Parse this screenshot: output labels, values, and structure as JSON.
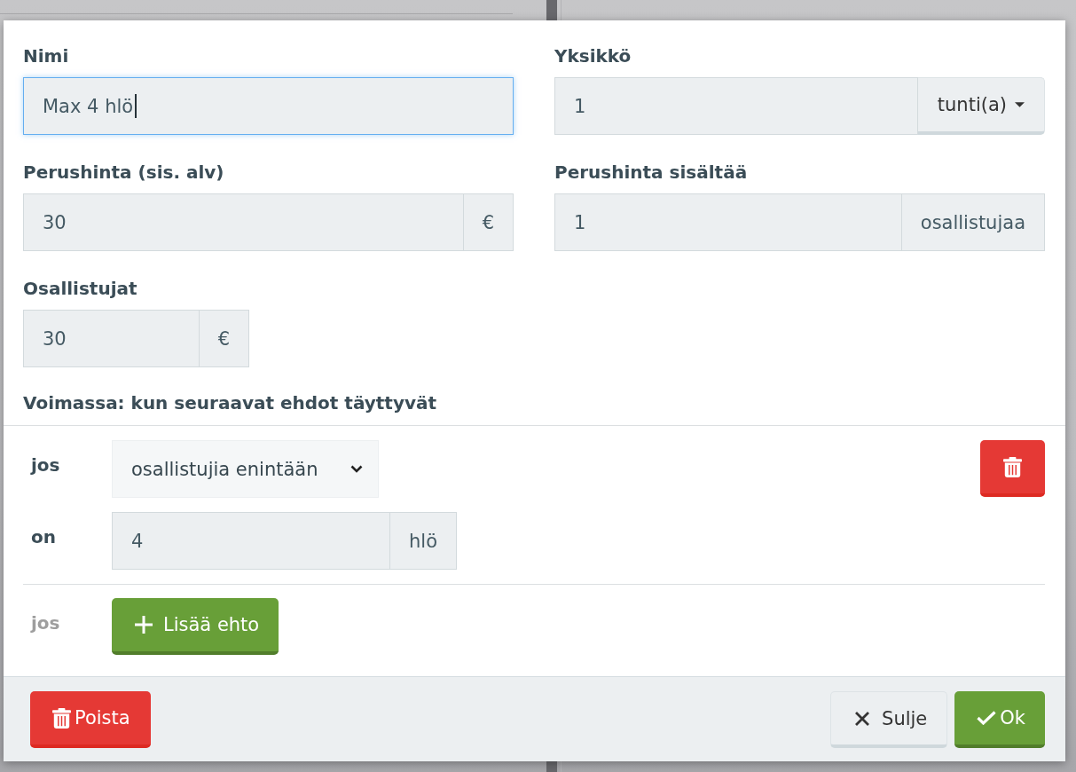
{
  "dialog": {
    "fields": [
      {
        "kind": "wide",
        "label": "Nimi",
        "value": "Max 4 hlö",
        "focused": true
      },
      {
        "kind": "wide",
        "label": "Yksikkö",
        "value": "1",
        "focused": false,
        "addon": {
          "kind": "dropdown",
          "text": "tunti(a)"
        }
      },
      {
        "kind": "wide",
        "label": "Perushinta (sis. alv)",
        "value": "30",
        "focused": false,
        "addon": {
          "kind": "text",
          "text": "€"
        }
      },
      {
        "kind": "wide",
        "label": "Perushinta sisältää",
        "value": "1",
        "focused": false,
        "addon": {
          "kind": "text",
          "text": "osallistujaa"
        }
      },
      {
        "kind": "compact",
        "label": "Osallistujat",
        "value": "30",
        "focused": false,
        "addon": {
          "kind": "text",
          "text": "€"
        }
      }
    ],
    "section_title": "Voimassa: kun seuraavat ehdot täyttyvät",
    "conditions": [
      {
        "kind": "select",
        "label": "jos",
        "muted": false,
        "value": "osallistujia enintään",
        "deletable": true
      },
      {
        "kind": "number",
        "label": "on",
        "muted": false,
        "value": "4",
        "unit": "hlö",
        "deletable": false
      },
      {
        "kind": "add",
        "label": "jos",
        "muted": true,
        "button": "Lisää ehto",
        "deletable": false
      }
    ],
    "footer_buttons": [
      {
        "kind": "danger",
        "label": "Poista"
      },
      {
        "kind": "default",
        "label": "Sulje"
      },
      {
        "kind": "primary",
        "label": "Ok"
      }
    ]
  }
}
